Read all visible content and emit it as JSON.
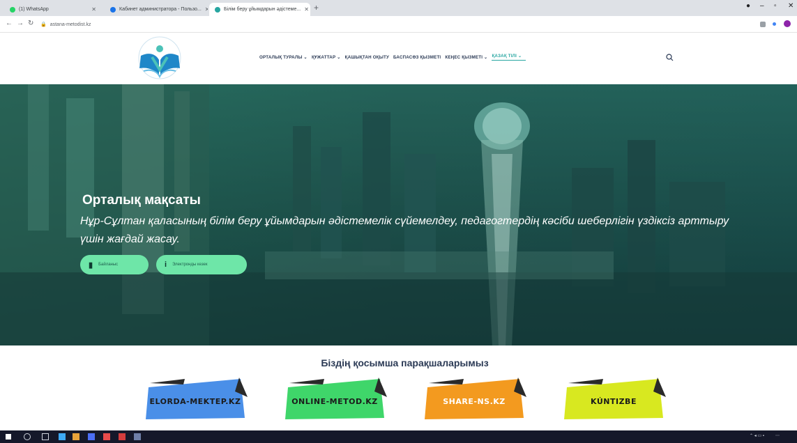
{
  "browser": {
    "tabs": [
      {
        "title": "(1) WhatsApp",
        "fav_color": "#25d366"
      },
      {
        "title": "Кабинет администратора - Пользо...",
        "fav_color": "#1a73e8"
      },
      {
        "title": "Білім беру ұйымдарын әдістеме...",
        "fav_color": "#27a6a1"
      }
    ],
    "url": "astana-metodist.kz"
  },
  "nav": {
    "items": [
      "ОРТАЛЫҚ ТУРАЛЫ ⌄",
      "ҚҰЖАТТАР ⌄",
      "ҚАШЫҚТАН ОҚЫТУ",
      "БАСПАСӨЗ ҚЫЗМЕТІ",
      "КЕҢЕС ҚЫЗМЕТІ ⌄",
      "ҚАЗАҚ ТІЛІ ⌄"
    ]
  },
  "hero": {
    "title": "Орталық мақсаты",
    "subtitle": "Нұр-Сұлтан қаласының білім беру ұйымдарын әдістемелік сүйемелдеу, педагогтердің кәсіби шеберлігін үздіксіз арттыру үшін жағдай жасау.",
    "btn1": "Байланыс",
    "btn2": "Электронды кезек"
  },
  "partners": {
    "title": "Біздің қосымша парақшаларымыз",
    "items": [
      {
        "label": "ELORDA-MEKTEP.KZ",
        "color": "#4a8fe8"
      },
      {
        "label": "ONLINE-METOD.KZ",
        "color": "#3fd66a"
      },
      {
        "label": "SHARE-NS.KZ",
        "color": "#f39a1f"
      },
      {
        "label": "KÚNTIZBE",
        "color": "#d8e820"
      }
    ]
  },
  "colors": {
    "accent": "#27a6a1",
    "button": "#6ee6a8",
    "nav_text": "#2b3a55"
  }
}
